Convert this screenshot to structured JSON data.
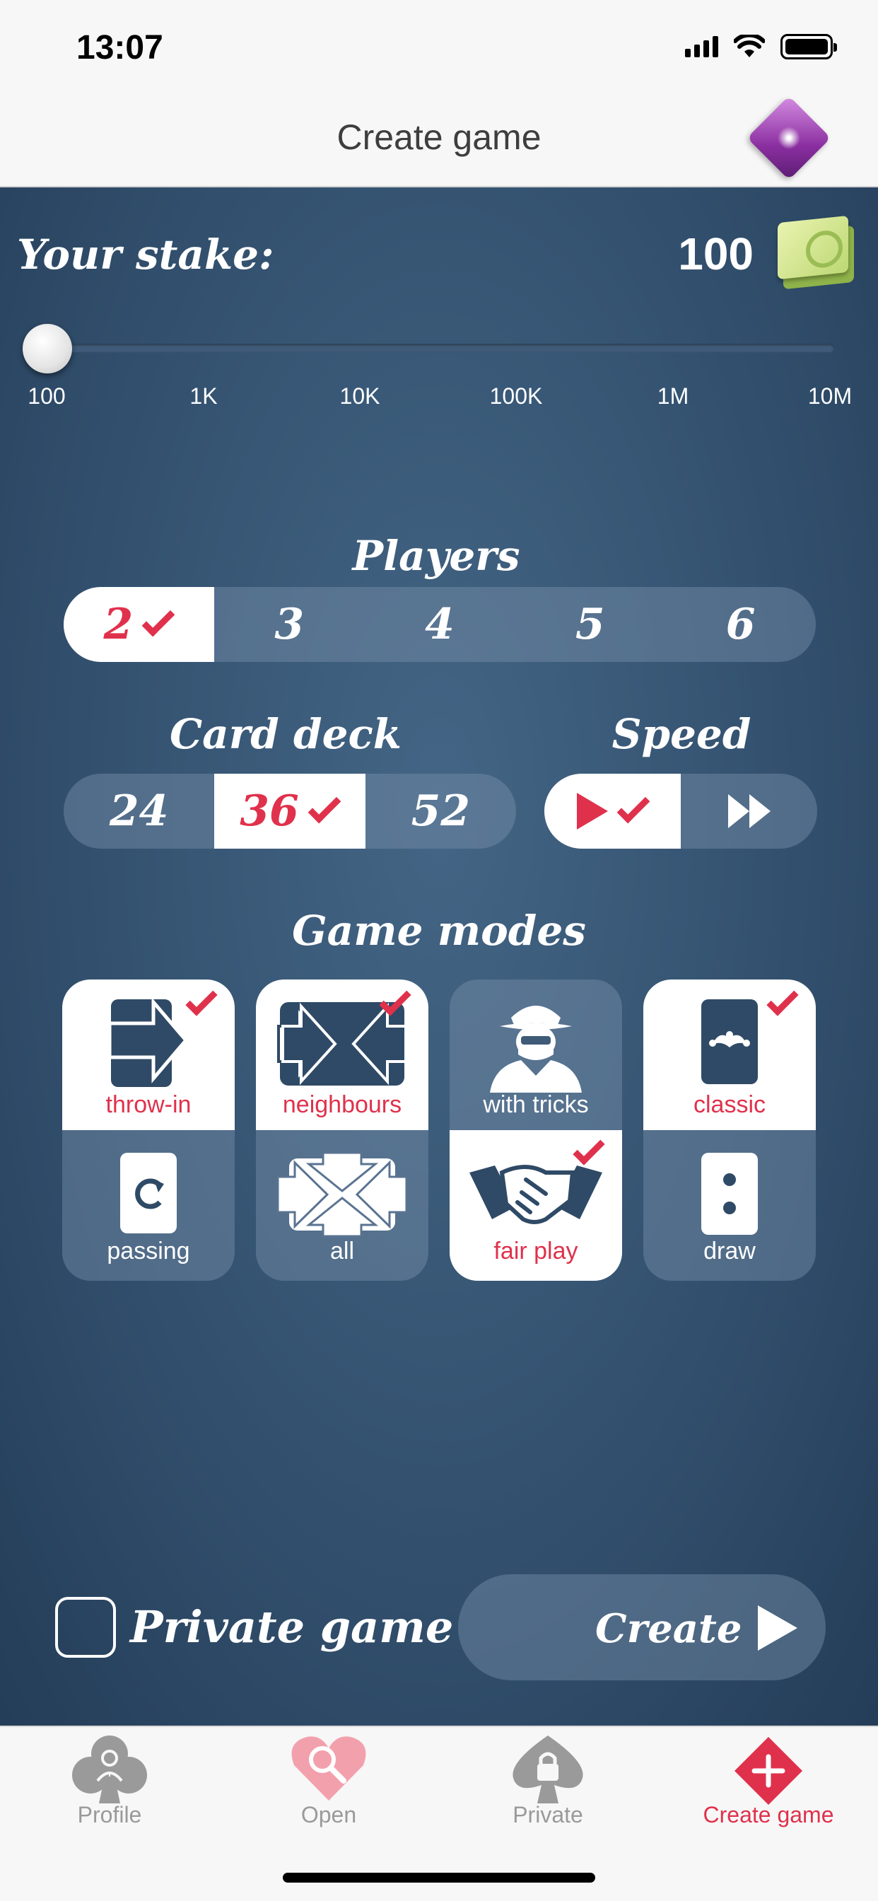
{
  "status": {
    "time": "13:07"
  },
  "nav": {
    "title": "Create game"
  },
  "stake": {
    "label": "Your stake:",
    "value": "100",
    "ticks": [
      "100",
      "1K",
      "10K",
      "100K",
      "1M",
      "10M"
    ],
    "slider_position_fraction": 0
  },
  "players": {
    "title": "Players",
    "options": [
      "2",
      "3",
      "4",
      "5",
      "6"
    ],
    "selected": "2"
  },
  "deck": {
    "title": "Card deck",
    "options": [
      "24",
      "36",
      "52"
    ],
    "selected": "36"
  },
  "speed": {
    "title": "Speed",
    "options": [
      "normal",
      "fast"
    ],
    "selected": "normal"
  },
  "modes": {
    "title": "Game modes",
    "columns": [
      {
        "top": {
          "label": "throw-in",
          "selected": true,
          "icon": "arrow-right-icon"
        },
        "bottom": {
          "label": "passing",
          "selected": false,
          "icon": "rotate-card-icon"
        }
      },
      {
        "top": {
          "label": "neighbours",
          "selected": true,
          "icon": "arrows-inward-icon"
        },
        "bottom": {
          "label": "all",
          "selected": false,
          "icon": "arrows-all-icon"
        }
      },
      {
        "top": {
          "label": "with tricks",
          "selected": false,
          "icon": "cheater-icon"
        },
        "bottom": {
          "label": "fair play",
          "selected": true,
          "icon": "handshake-icon"
        }
      },
      {
        "top": {
          "label": "classic",
          "selected": true,
          "icon": "jester-card-icon"
        },
        "bottom": {
          "label": "draw",
          "selected": false,
          "icon": "dots-card-icon"
        }
      }
    ]
  },
  "private_game": {
    "label": "Private game",
    "checked": false
  },
  "create_button": {
    "label": "Create"
  },
  "tabs": [
    {
      "label": "Profile",
      "icon": "club-profile-icon",
      "active": false
    },
    {
      "label": "Open",
      "icon": "heart-search-icon",
      "active": false
    },
    {
      "label": "Private",
      "icon": "spade-lock-icon",
      "active": false
    },
    {
      "label": "Create game",
      "icon": "diamond-plus-icon",
      "active": true
    }
  ],
  "colors": {
    "accent": "#e0314c",
    "background": "#33516f"
  }
}
